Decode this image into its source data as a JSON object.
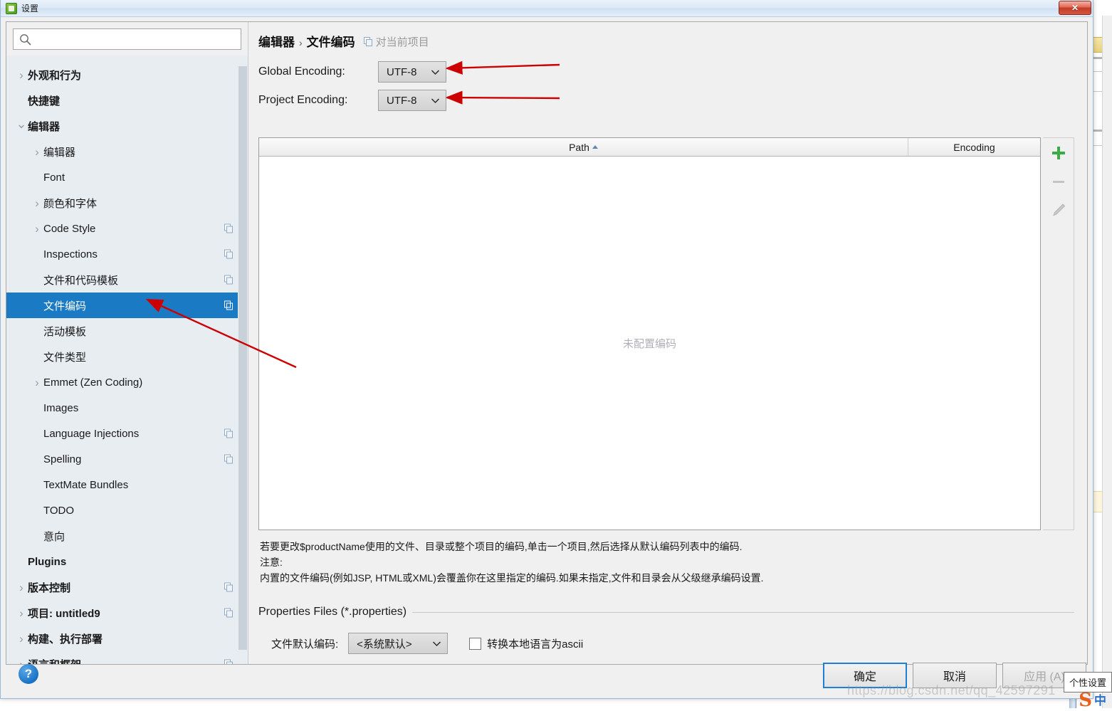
{
  "window": {
    "title": "设置",
    "icon": "app-icon",
    "close_label": "✕"
  },
  "sidebar": {
    "search": {
      "placeholder": "",
      "value": "",
      "icon": "search-icon"
    },
    "items": [
      {
        "label": "外观和行为",
        "indent": 0,
        "twisty": "collapsed",
        "bold": true,
        "badge": false,
        "selected": false
      },
      {
        "label": "快捷键",
        "indent": 0,
        "twisty": "none",
        "bold": true,
        "badge": false,
        "selected": false
      },
      {
        "label": "编辑器",
        "indent": 0,
        "twisty": "expanded",
        "bold": true,
        "badge": false,
        "selected": false
      },
      {
        "label": "编辑器",
        "indent": 1,
        "twisty": "collapsed",
        "bold": false,
        "badge": false,
        "selected": false
      },
      {
        "label": "Font",
        "indent": 1,
        "twisty": "none",
        "bold": false,
        "badge": false,
        "selected": false
      },
      {
        "label": "颜色和字体",
        "indent": 1,
        "twisty": "collapsed",
        "bold": false,
        "badge": false,
        "selected": false
      },
      {
        "label": "Code Style",
        "indent": 1,
        "twisty": "collapsed",
        "bold": false,
        "badge": true,
        "selected": false
      },
      {
        "label": "Inspections",
        "indent": 1,
        "twisty": "none",
        "bold": false,
        "badge": true,
        "selected": false
      },
      {
        "label": "文件和代码模板",
        "indent": 1,
        "twisty": "none",
        "bold": false,
        "badge": true,
        "selected": false
      },
      {
        "label": "文件编码",
        "indent": 1,
        "twisty": "none",
        "bold": false,
        "badge": true,
        "selected": true
      },
      {
        "label": "活动模板",
        "indent": 1,
        "twisty": "none",
        "bold": false,
        "badge": false,
        "selected": false
      },
      {
        "label": "文件类型",
        "indent": 1,
        "twisty": "none",
        "bold": false,
        "badge": false,
        "selected": false
      },
      {
        "label": "Emmet (Zen Coding)",
        "indent": 1,
        "twisty": "collapsed",
        "bold": false,
        "badge": false,
        "selected": false
      },
      {
        "label": "Images",
        "indent": 1,
        "twisty": "none",
        "bold": false,
        "badge": false,
        "selected": false
      },
      {
        "label": "Language Injections",
        "indent": 1,
        "twisty": "none",
        "bold": false,
        "badge": true,
        "selected": false
      },
      {
        "label": "Spelling",
        "indent": 1,
        "twisty": "none",
        "bold": false,
        "badge": true,
        "selected": false
      },
      {
        "label": "TextMate Bundles",
        "indent": 1,
        "twisty": "none",
        "bold": false,
        "badge": false,
        "selected": false
      },
      {
        "label": "TODO",
        "indent": 1,
        "twisty": "none",
        "bold": false,
        "badge": false,
        "selected": false
      },
      {
        "label": "意向",
        "indent": 1,
        "twisty": "none",
        "bold": false,
        "badge": false,
        "selected": false
      },
      {
        "label": "Plugins",
        "indent": 0,
        "twisty": "none",
        "bold": true,
        "badge": false,
        "selected": false
      },
      {
        "label": "版本控制",
        "indent": 0,
        "twisty": "collapsed",
        "bold": true,
        "badge": true,
        "selected": false
      },
      {
        "label": "项目: untitled9",
        "indent": 0,
        "twisty": "collapsed",
        "bold": true,
        "badge": true,
        "selected": false
      },
      {
        "label": "构建、执行部署",
        "indent": 0,
        "twisty": "collapsed",
        "bold": true,
        "badge": false,
        "selected": false
      },
      {
        "label": "语言和框架",
        "indent": 0,
        "twisty": "collapsed",
        "bold": true,
        "badge": true,
        "selected": false
      }
    ]
  },
  "main": {
    "breadcrumb": {
      "parent": "编辑器",
      "separator": "›",
      "current": "文件编码",
      "note": "对当前项目",
      "note_icon": "copy-badge-icon"
    },
    "global_encoding": {
      "label": "Global Encoding:",
      "value": "UTF-8"
    },
    "project_encoding": {
      "label": "Project Encoding:",
      "value": "UTF-8"
    },
    "table": {
      "columns": [
        "Path",
        "Encoding"
      ],
      "sort_column": "Path",
      "sort_direction": "asc",
      "rows": [],
      "empty_text": "未配置编码"
    },
    "table_tools": [
      {
        "name": "add-button",
        "glyph": "+"
      },
      {
        "name": "remove-button",
        "glyph": "−"
      },
      {
        "name": "edit-button",
        "glyph": "✎"
      }
    ],
    "description": [
      "若要更改$productName使用的文件、目录或整个项目的编码,单击一个项目,然后选择从默认编码列表中的编码.",
      "注意:",
      "内置的文件编码(例如JSP, HTML或XML)会覆盖你在这里指定的编码.如果未指定,文件和目录会从父级继承编码设置."
    ],
    "properties_group": {
      "title": "Properties Files (*.properties)",
      "default_encoding_label": "文件默认编码:",
      "default_encoding_value": "<系统默认>",
      "transparent_native_label": "转换本地语言为ascii",
      "transparent_native_checked": false
    }
  },
  "footer": {
    "help_label": "?",
    "buttons": [
      {
        "label": "确定",
        "state": "default"
      },
      {
        "label": "取消",
        "state": "normal"
      },
      {
        "label": "应用 (A)",
        "state": "disabled"
      }
    ]
  },
  "overlay": {
    "tooltip": "个性设置",
    "watermark": "https://blog.csdn.net/qq_42597291",
    "ime_s": "S",
    "ime_cn": "中"
  },
  "colors": {
    "selection": "#1a7ac4",
    "annotation_arrow": "#cc0000",
    "accent_add": "#3aab45",
    "sidebar_bg": "#e8edf2",
    "dialog_bg": "#f0f0f0"
  }
}
